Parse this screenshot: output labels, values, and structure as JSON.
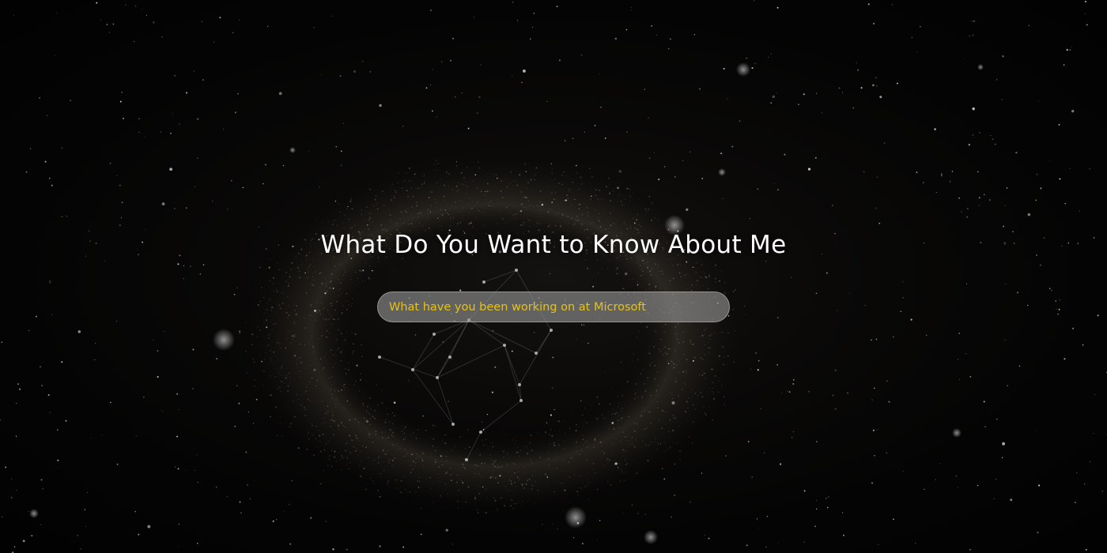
{
  "page": {
    "title": "What Do You Want to Know About Me"
  },
  "search": {
    "value": "What have you been working on at Microsoft",
    "placeholder": ""
  },
  "background": {
    "icon": "nebula-starfield-image",
    "base_color": "#050505",
    "nebula_color": "#8a7c6a"
  },
  "colors": {
    "title_text": "#ffffff",
    "input_text": "#e5c21a",
    "input_background": "#969696"
  }
}
